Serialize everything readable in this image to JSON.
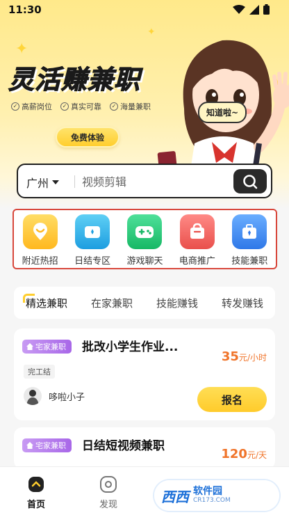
{
  "status_bar": {
    "time": "11:30"
  },
  "banner": {
    "headline": "灵活赚兼职",
    "features": [
      "高薪岗位",
      "真实可靠",
      "海量兼职"
    ],
    "trial_button": "免费体验",
    "bubble": "知道啦~"
  },
  "search": {
    "city": "广州",
    "query": "视频剪辑"
  },
  "categories": [
    {
      "label": "附近热招",
      "color": "#ffc72e"
    },
    {
      "label": "日结专区",
      "color": "#2fb6ea"
    },
    {
      "label": "游戏聊天",
      "color": "#2fd07a"
    },
    {
      "label": "电商推广",
      "color": "#f06462"
    },
    {
      "label": "技能兼职",
      "color": "#3d8cf0"
    }
  ],
  "tabs": [
    "精选兼职",
    "在家兼职",
    "技能赚钱",
    "转发赚钱"
  ],
  "jobs": [
    {
      "tag": "宅家兼职",
      "title": "批改小学生作业...",
      "salary_amount": "35",
      "salary_unit": "元/小时",
      "chip": "完工结",
      "poster": "哆啦小子",
      "apply": "报名"
    },
    {
      "tag": "宅家兼职",
      "title": "日结短视频兼职",
      "salary_amount": "120",
      "salary_unit": "元/天"
    }
  ],
  "bottom_nav": [
    {
      "label": "首页",
      "active": true
    },
    {
      "label": "发现",
      "active": false
    }
  ],
  "watermark": {
    "main": "西西",
    "side_top": "软件园",
    "side_bottom": "CR173.COM"
  },
  "colors": {
    "accent": "#ffce2e",
    "salary": "#f0742a",
    "tag": "#a867e8",
    "highlight_border": "#d8473b"
  }
}
